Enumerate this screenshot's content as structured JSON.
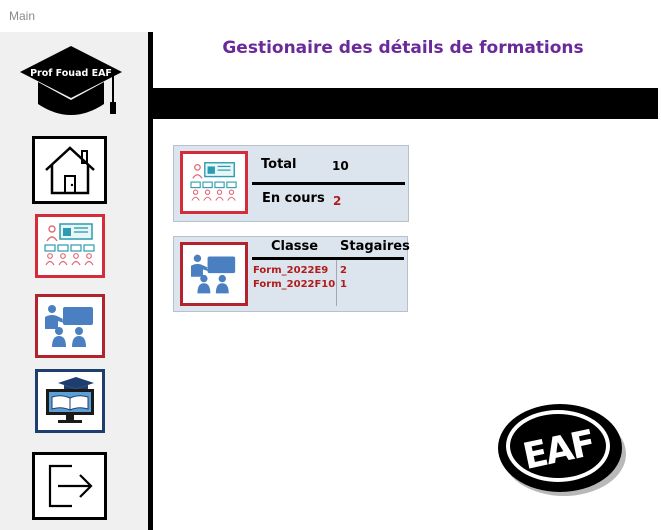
{
  "window": {
    "title": "Main"
  },
  "sidebar": {
    "logo_text": "Prof Fouad EAF",
    "items": [
      {
        "name": "home",
        "border": "#000000"
      },
      {
        "name": "formations",
        "border": "#d42c3a"
      },
      {
        "name": "classes",
        "border": "#b3232d"
      },
      {
        "name": "e-learning",
        "border": "#1f3e70"
      },
      {
        "name": "exit",
        "border": "#000000"
      }
    ]
  },
  "header": {
    "title": "Gestionaire des détails de formations"
  },
  "stats": {
    "total_label": "Total",
    "total_value": "10",
    "encours_label": "En cours",
    "encours_value": "2"
  },
  "classes": {
    "headers": [
      "Classe",
      "Stagaires"
    ],
    "rows": [
      {
        "classe": "Form_2022E9",
        "stagaires": "2"
      },
      {
        "classe": "Form_2022F10",
        "stagaires": "1"
      }
    ]
  },
  "brand": {
    "logo_text": "EAF"
  },
  "colors": {
    "title": "#6a2a9a",
    "accent_red": "#b01c1c",
    "card_bg": "#dce4ee"
  }
}
